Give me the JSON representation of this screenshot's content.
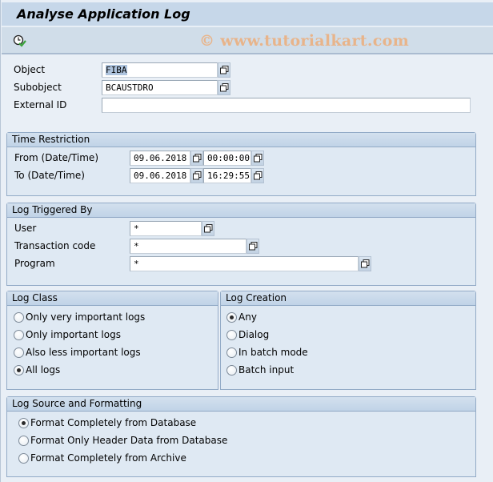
{
  "window": {
    "title": "Analyse Application Log",
    "watermark": "© www.tutorialkart.com"
  },
  "toolbar": {
    "execute_icon": "clock-execute-icon"
  },
  "selection": {
    "object": {
      "label": "Object",
      "value": "FIBA"
    },
    "subobject": {
      "label": "Subobject",
      "value": "BCAUSTDRO"
    },
    "external_id": {
      "label": "External ID",
      "value": ""
    }
  },
  "time_restriction": {
    "title": "Time Restriction",
    "from": {
      "label": "From (Date/Time)",
      "date": "09.06.2018",
      "time": "00:00:00"
    },
    "to": {
      "label": "To (Date/Time)",
      "date": "09.06.2018",
      "time": "16:29:55"
    }
  },
  "log_triggered_by": {
    "title": "Log Triggered By",
    "user": {
      "label": "User",
      "value": "*"
    },
    "transaction_code": {
      "label": "Transaction code",
      "value": "*"
    },
    "program": {
      "label": "Program",
      "value": "*"
    }
  },
  "log_class": {
    "title": "Log Class",
    "options": [
      {
        "label": "Only very important logs",
        "selected": false
      },
      {
        "label": "Only important logs",
        "selected": false
      },
      {
        "label": "Also less important logs",
        "selected": false
      },
      {
        "label": "All logs",
        "selected": true
      }
    ]
  },
  "log_creation": {
    "title": "Log Creation",
    "options": [
      {
        "label": "Any",
        "selected": true
      },
      {
        "label": "Dialog",
        "selected": false
      },
      {
        "label": "In batch mode",
        "selected": false
      },
      {
        "label": "Batch input",
        "selected": false
      }
    ]
  },
  "log_source": {
    "title": "Log Source and Formatting",
    "options": [
      {
        "label": "Format Completely from Database",
        "selected": true
      },
      {
        "label": "Format Only Header Data from Database",
        "selected": false
      },
      {
        "label": "Format Completely from Archive",
        "selected": false
      }
    ]
  },
  "colors": {
    "background": "#e9eff6",
    "title_bar": "#c6d7e9",
    "toolbar": "#d0dde9",
    "group_header": "#c8d9ea",
    "group_body": "#dfe9f3",
    "selection_highlight": "#aec4de",
    "watermark": "#e8b48a"
  }
}
